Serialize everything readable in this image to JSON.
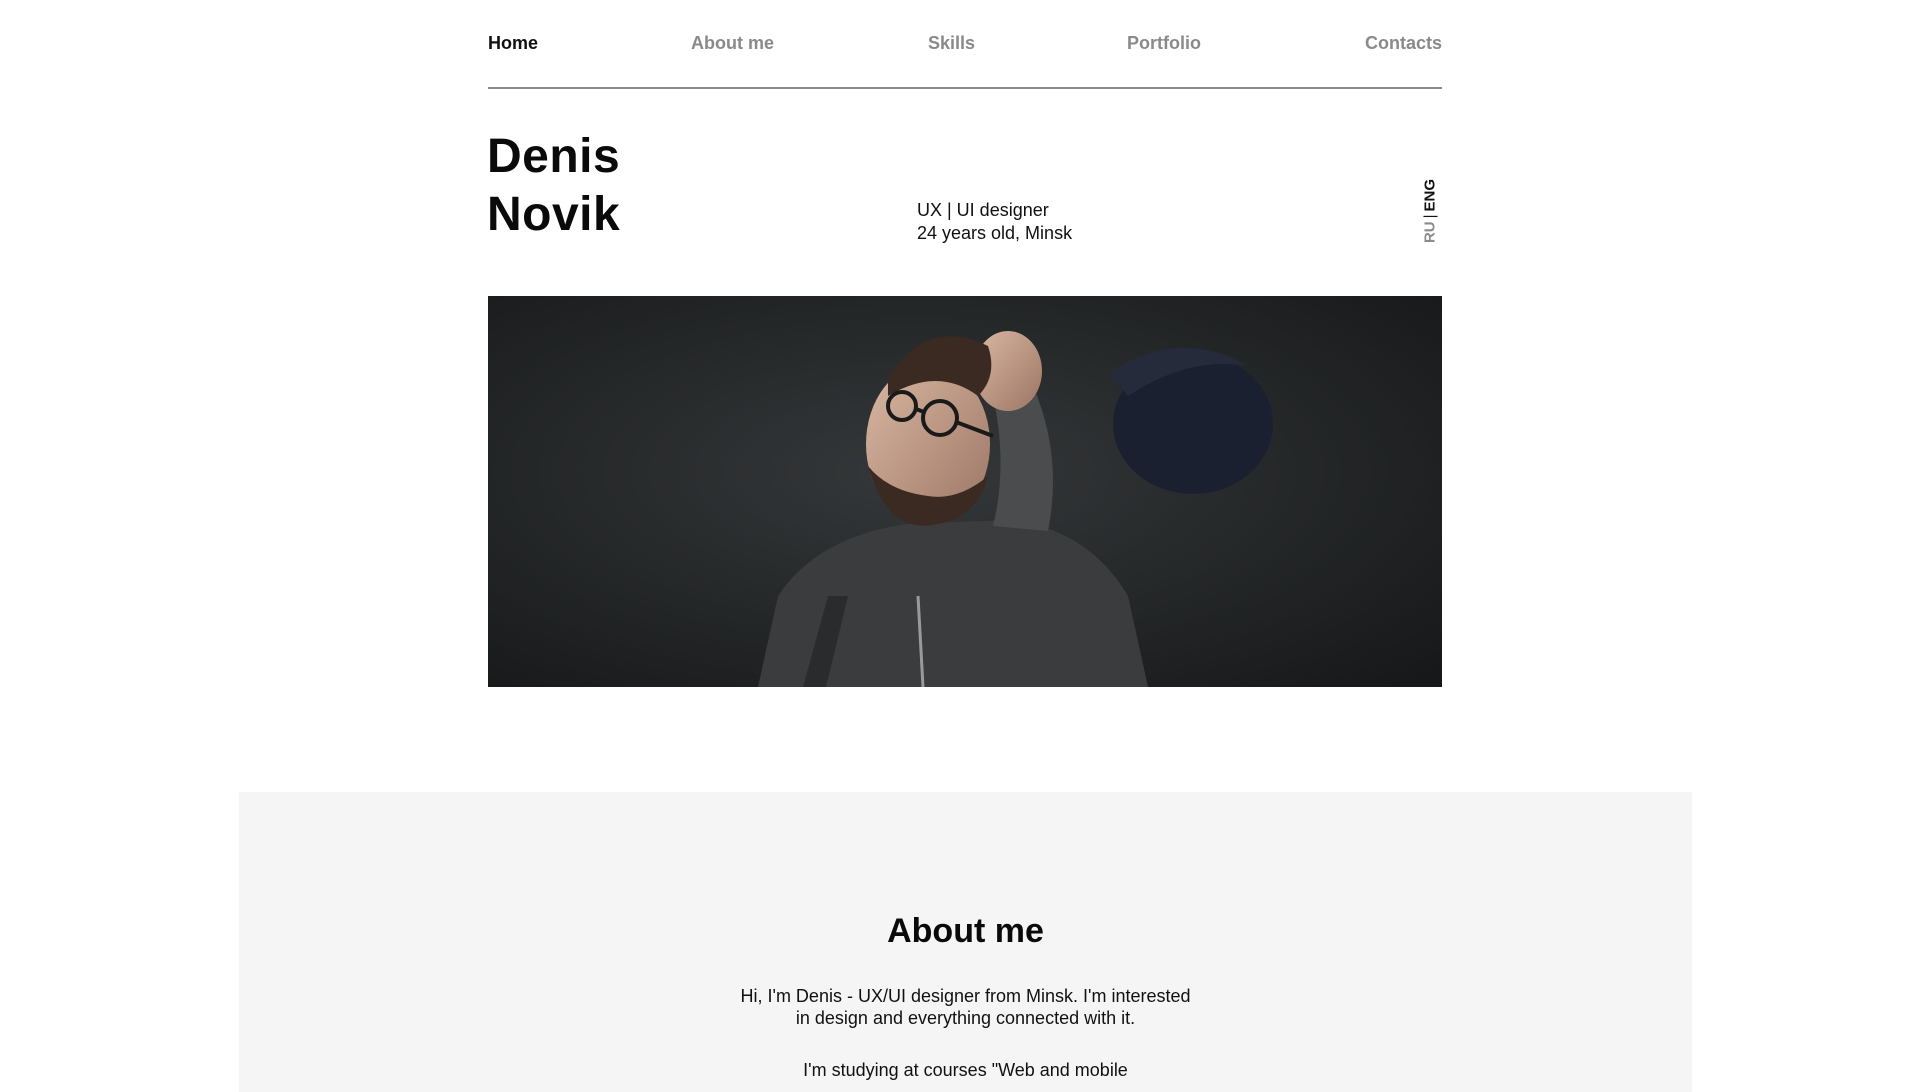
{
  "nav": {
    "items": [
      {
        "label": "Home",
        "active": true
      },
      {
        "label": "About me",
        "active": false
      },
      {
        "label": "Skills",
        "active": false
      },
      {
        "label": "Portfolio",
        "active": false
      },
      {
        "label": "Contacts",
        "active": false
      }
    ]
  },
  "hero": {
    "first_name": "Denis",
    "last_name": "Novik",
    "role": "UX | UI designer",
    "details": "24 years old, Minsk",
    "photo_alt_icon": "portrait-photo"
  },
  "lang": {
    "ru": "RU",
    "separator": "|",
    "eng": "ENG",
    "active": "ENG"
  },
  "about": {
    "title": "About me",
    "p1_line1": "Hi, I'm Denis - UX/UI designer from Minsk. I'm interested",
    "p1_line2": "in design and everything connected with it.",
    "p2_line1": "I'm studying at courses \"Web and mobile"
  },
  "colors": {
    "text": "#111111",
    "muted": "#8a8a8a",
    "about_bg": "#f5f5f5",
    "photo_bg": "#242628"
  }
}
